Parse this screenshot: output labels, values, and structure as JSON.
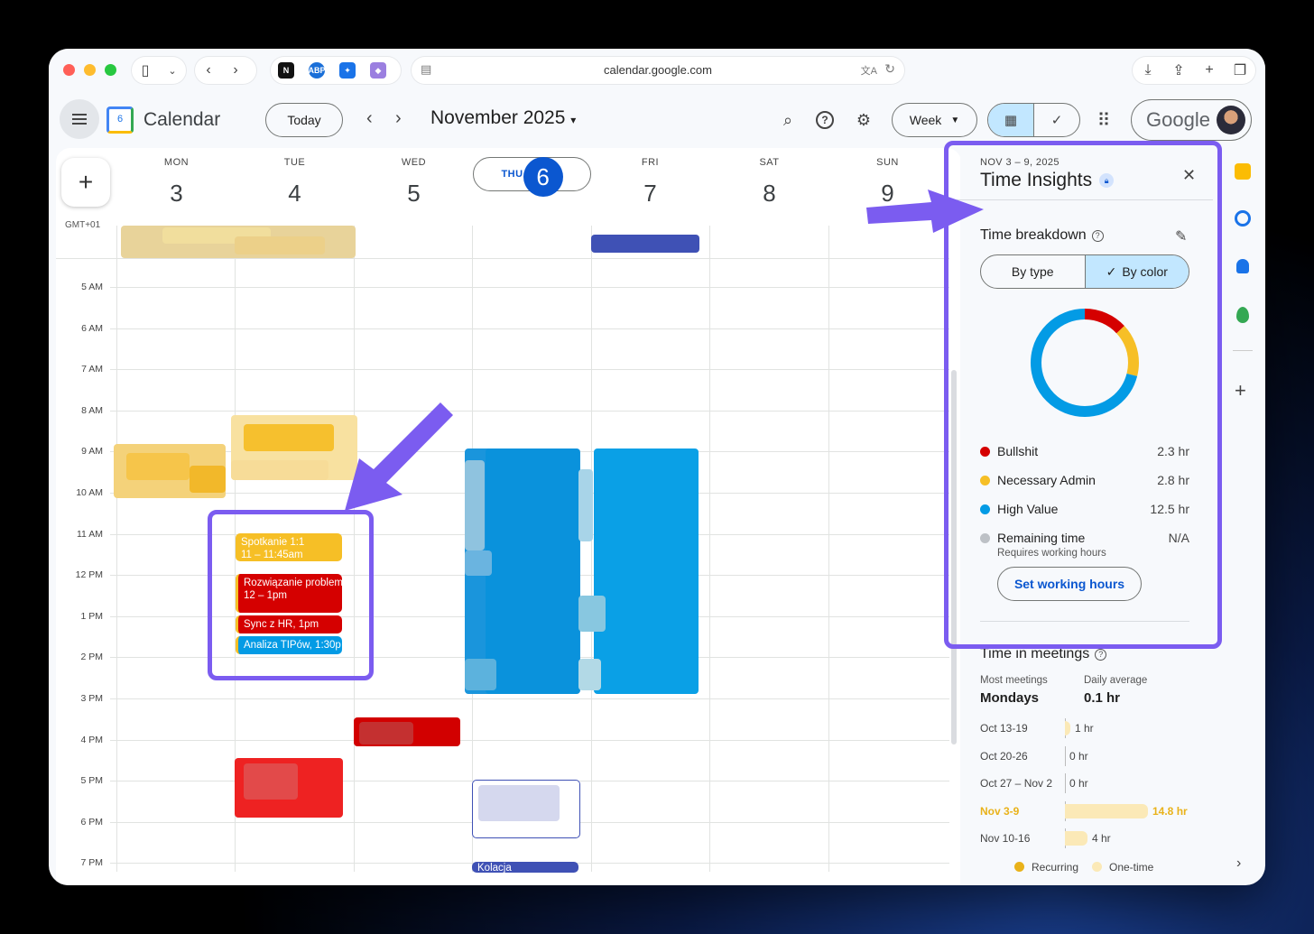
{
  "browser": {
    "url": "calendar.google.com"
  },
  "header": {
    "app_name": "Calendar",
    "logo_day": "6",
    "today_label": "Today",
    "month_label": "November 2025",
    "view_label": "Week",
    "account_label": "Google"
  },
  "calendar": {
    "timezone": "GMT+01",
    "days": [
      {
        "dow": "MON",
        "num": "3"
      },
      {
        "dow": "TUE",
        "num": "4"
      },
      {
        "dow": "WED",
        "num": "5"
      },
      {
        "dow": "THU",
        "num": "6"
      },
      {
        "dow": "FRI",
        "num": "7"
      },
      {
        "dow": "SAT",
        "num": "8"
      },
      {
        "dow": "SUN",
        "num": "9"
      }
    ],
    "hours": [
      "5 AM",
      "6 AM",
      "7 AM",
      "8 AM",
      "9 AM",
      "10 AM",
      "11 AM",
      "12 PM",
      "1 PM",
      "2 PM",
      "3 PM",
      "4 PM",
      "5 PM",
      "6 PM",
      "7 PM"
    ],
    "events": [
      {
        "title": "Spotkanie 1:1",
        "time": "11 – 11:45am",
        "color": "#f6bf26"
      },
      {
        "title": "Rozwiązanie problem",
        "time": "12 – 1pm",
        "color": "#d50000"
      },
      {
        "title": "Sync z HR, 1pm",
        "color": "#d50000"
      },
      {
        "title": "Analiza TIPów, 1:30p",
        "color": "#039be5"
      },
      {
        "title": "Kolacja",
        "color": "#3f51b5"
      }
    ]
  },
  "insights": {
    "date_range": "NOV 3 – 9, 2025",
    "title": "Time Insights",
    "breakdown_title": "Time breakdown",
    "tab_by_type": "By type",
    "tab_by_color": "By color",
    "categories": [
      {
        "name": "Bullshit",
        "value": "2.3 hr",
        "color": "#d50000"
      },
      {
        "name": "Necessary Admin",
        "value": "2.8 hr",
        "color": "#f6bf26"
      },
      {
        "name": "High Value",
        "value": "12.5 hr",
        "color": "#039be5"
      },
      {
        "name": "Remaining time",
        "value": "N/A",
        "sub": "Requires working hours",
        "color": "#bdc1c6"
      }
    ],
    "set_working_hours": "Set working hours",
    "meetings_title": "Time in meetings",
    "most_meetings_label": "Most meetings",
    "most_meetings_value": "Mondays",
    "daily_avg_label": "Daily average",
    "daily_avg_value": "0.1 hr",
    "weeks": [
      {
        "label": "Oct 13-19",
        "value": "1 hr",
        "hours": 1
      },
      {
        "label": "Oct 20-26",
        "value": "0 hr",
        "hours": 0
      },
      {
        "label": "Oct 27 – Nov 2",
        "value": "0 hr",
        "hours": 0
      },
      {
        "label": "Nov 3-9",
        "value": "14.8 hr",
        "hours": 14.8
      },
      {
        "label": "Nov 10-16",
        "value": "4 hr",
        "hours": 4
      }
    ],
    "legend_recurring": "Recurring",
    "legend_onetime": "One-time"
  },
  "colors": {
    "accent": "#0b57d0",
    "annotation": "#7b5cf0"
  }
}
